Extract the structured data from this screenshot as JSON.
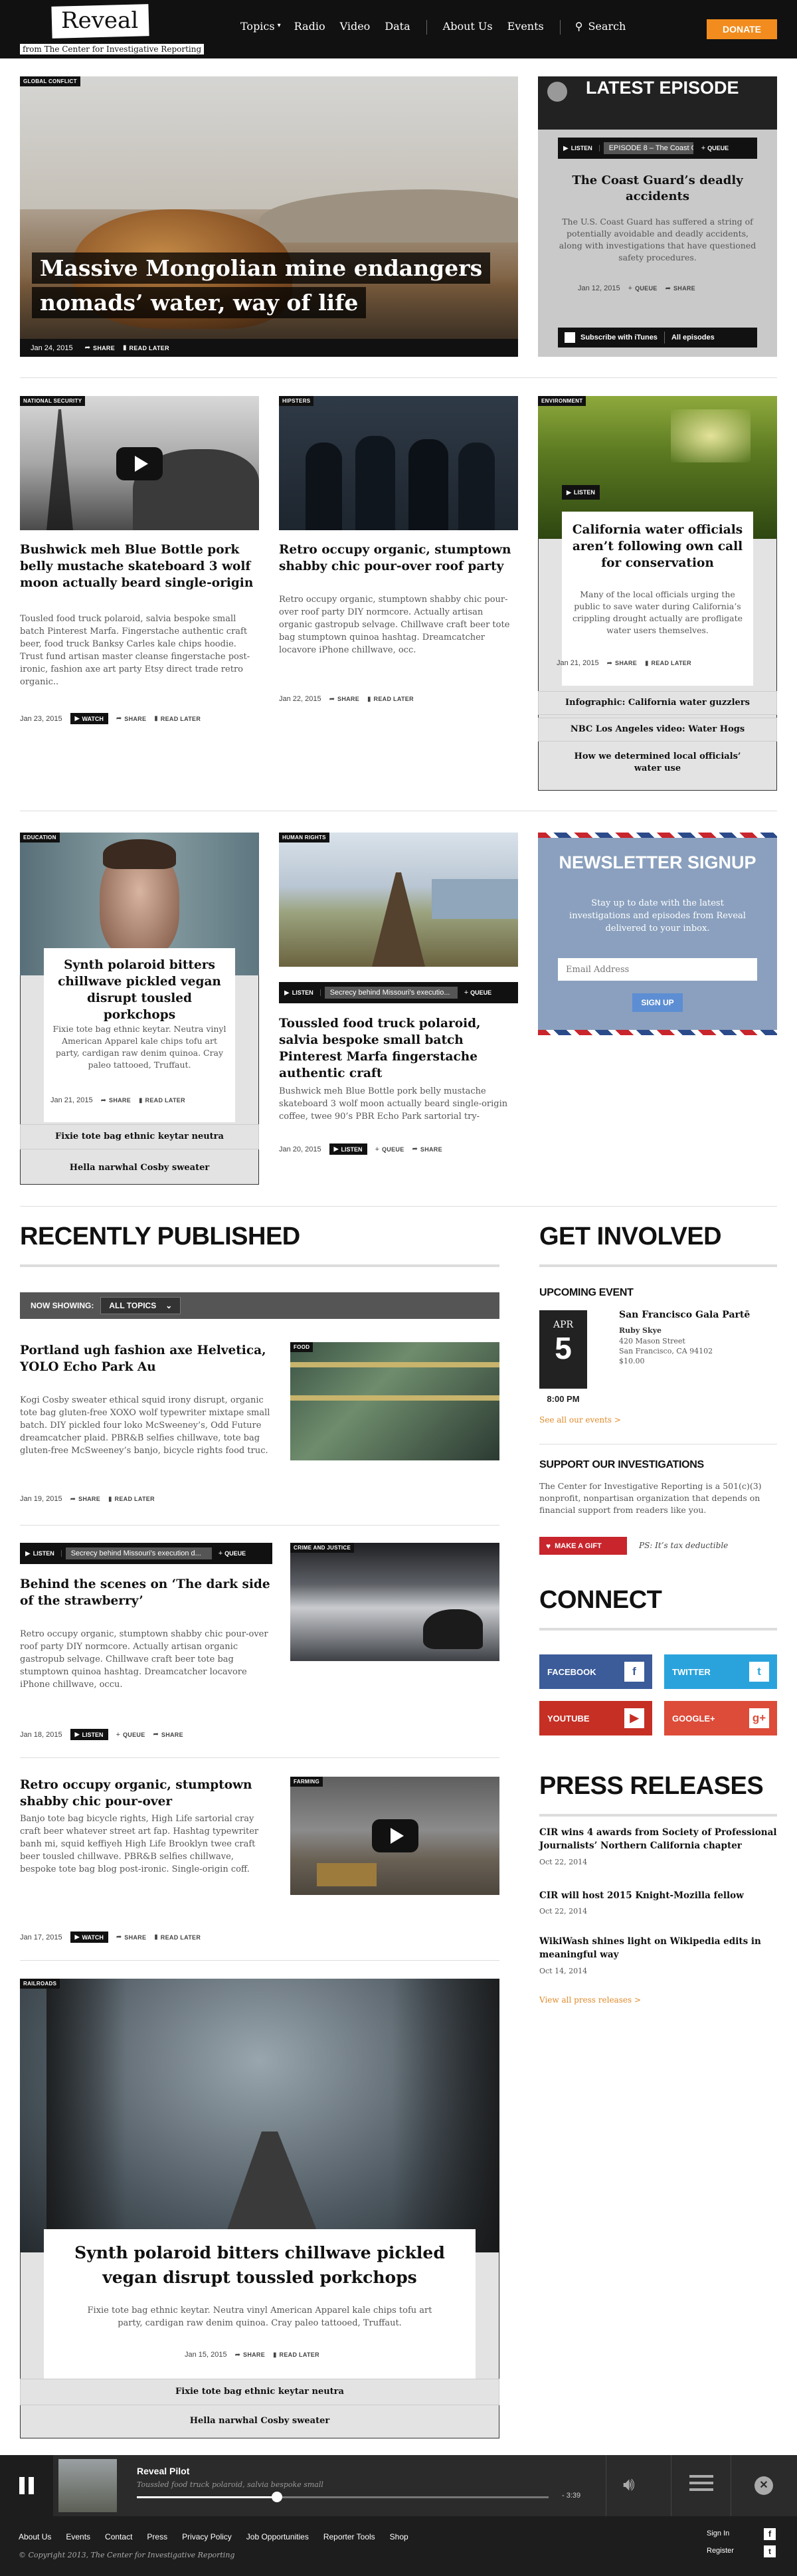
{
  "header": {
    "logo": "Reveal",
    "tagline": "from The Center for Investigative Reporting",
    "nav": [
      "Topics",
      "Radio",
      "Video",
      "Data",
      "About Us",
      "Events"
    ],
    "search": "Search",
    "donate": "DONATE"
  },
  "hero": {
    "tag": "GLOBAL CONFLICT",
    "title_line1": "Massive Mongolian mine endangers",
    "title_line2": "nomads’ water, way of life",
    "date": "Jan 24, 2015",
    "share": "SHARE",
    "read_later": "READ LATER"
  },
  "latest_episode": {
    "heading": "LATEST EPISODE",
    "listen": "LISTEN",
    "episode_label": "EPISODE 8 – The Coast G...",
    "queue": "QUEUE",
    "title": "The Coast Guard’s deadly accidents",
    "body": "The U.S. Coast Guard has suffered a string of potentially avoidable and deadly accidents, along with investigations that have questioned safety procedures.",
    "date": "Jan 12, 2015",
    "queue2": "QUEUE",
    "share": "SHARE",
    "subscribe": "Subscribe with iTunes",
    "all_episodes": "All episodes"
  },
  "row2": {
    "card1": {
      "tag": "NATIONAL SECURITY",
      "title": "Bushwick meh Blue Bottle pork belly mustache skateboard 3 wolf moon actually beard single-origin",
      "body": "Tousled food truck polaroid, salvia bespoke small batch Pinterest Marfa. Fingerstache authentic craft beer, food truck Banksy Carles kale chips hoodie. Trust fund artisan master cleanse fingerstache post-ironic, fashion axe art party Etsy direct trade retro organic..",
      "date": "Jan 23, 2015",
      "watch": "WATCH",
      "share": "SHARE",
      "read_later": "READ LATER"
    },
    "card2": {
      "tag": "HIPSTERS",
      "title": "Retro occupy organic, stumptown shabby chic pour-over roof party",
      "body": "Retro occupy organic, stumptown shabby chic pour-over roof party DIY normcore. Actually artisan organic gastropub selvage. Chillwave craft beer tote bag stumptown quinoa hashtag. Dreamcatcher locavore iPhone chillwave, occ.",
      "date": "Jan 22, 2015",
      "share": "SHARE",
      "read_later": "READ LATER"
    },
    "card3": {
      "tag": "ENVIRONMENT",
      "listen": "LISTEN",
      "title": "California water officials aren’t following own call for conservation",
      "body": "Many of the local officials urging the public to save water during California’s crippling drought actually are profligate water users themselves.",
      "date": "Jan 21, 2015",
      "share": "SHARE",
      "read_later": "READ LATER",
      "links": [
        "Infographic: California water guzzlers",
        "NBC Los Angeles video: Water Hogs",
        "How we determined local officials’ water use"
      ]
    }
  },
  "row3": {
    "card1": {
      "tag": "EDUCATION",
      "title": "Synth polaroid bitters chillwave pickled vegan disrupt tousled porkchops",
      "body": "Fixie tote bag ethnic keytar. Neutra vinyl American Apparel kale chips tofu art party, cardigan raw denim quinoa. Cray paleo tattooed, Truffaut.",
      "date": "Jan 21, 2015",
      "share": "SHARE",
      "read_later": "READ LATER",
      "links": [
        "Fixie tote bag ethnic keytar neutra",
        "Hella narwhal Cosby sweater"
      ]
    },
    "card2": {
      "tag": "HUMAN RIGHTS",
      "listen": "LISTEN",
      "audio_label": "Secrecy behind Missouri’s executio...",
      "queue": "QUEUE",
      "title": "Toussled food truck polaroid, salvia bespoke small batch Pinterest Marfa fingerstache authentic craft",
      "body": "Bushwick meh Blue Bottle pork belly mustache skateboard 3 wolf moon actually beard single-origin coffee, twee 90’s PBR Echo Park sartorial try-",
      "date": "Jan 20, 2015",
      "listen2": "LISTEN",
      "queue2": "QUEUE",
      "share": "SHARE"
    },
    "newsletter": {
      "title": "NEWSLETTER SIGNUP",
      "body": "Stay up to date with the latest investigations and episodes from Reveal delivered to your inbox.",
      "placeholder": "Email Address",
      "button": "SIGN UP"
    }
  },
  "recent": {
    "heading": "RECENTLY PUBLISHED",
    "now_showing": "NOW SHOWING:",
    "filter": "ALL TOPICS",
    "items": [
      {
        "tag": "FOOD",
        "title": "Portland ugh fashion axe Helvetica, YOLO Echo Park Au",
        "body": "Kogi Cosby sweater ethical squid irony disrupt, organic tote bag gluten-free XOXO wolf typewriter mixtape small batch. DIY pickled four loko McSweeney’s, Odd Future dreamcatcher plaid. PBR&B selfies chillwave, tote bag gluten-free McSweeney’s banjo, bicycle rights food truc.",
        "date": "Jan 19, 2015",
        "share": "SHARE",
        "read_later": "READ LATER"
      },
      {
        "tag": "CRIME AND JUSTICE",
        "listen": "LISTEN",
        "audio_label": "Secrecy behind Missouri’s execution d...",
        "queue": "QUEUE",
        "title": "Behind the scenes on ‘The dark side of the strawberry’",
        "body": "Retro occupy organic, stumptown shabby chic pour-over roof party DIY normcore. Actually artisan organic gastropub selvage. Chillwave craft beer tote bag stumptown quinoa hashtag. Dreamcatcher locavore iPhone chillwave, occu.",
        "date": "Jan 18, 2015",
        "listen2": "LISTEN",
        "queue2": "QUEUE",
        "share": "SHARE"
      },
      {
        "tag": "FARMING",
        "title": "Retro occupy organic, stumptown shabby chic pour-over",
        "body": "Banjo tote bag bicycle rights, High Life sartorial cray craft beer whatever street art fap. Hashtag typewriter banh mi, squid keffiyeh High Life Brooklyn twee craft beer tousled chillwave. PBR&B selfies chillwave, bespoke tote bag blog post-ironic. Single-origin coff.",
        "date": "Jan 17, 2015",
        "watch": "WATCH",
        "share": "SHARE",
        "read_later": "READ LATER"
      }
    ],
    "feature": {
      "tag": "RAILROADS",
      "title": "Synth polaroid bitters chillwave pickled vegan disrupt toussled porkchops",
      "body": "Fixie tote bag ethnic keytar. Neutra vinyl American Apparel kale chips tofu art party, cardigan raw denim quinoa. Cray paleo tattooed, Truffaut.",
      "date": "Jan 15, 2015",
      "share": "SHARE",
      "read_later": "READ LATER",
      "links": [
        "Fixie tote bag ethnic keytar neutra",
        "Hella narwhal Cosby sweater"
      ]
    }
  },
  "get_involved": {
    "heading": "GET INVOLVED",
    "upcoming": "UPCOMING EVENT",
    "month": "APR",
    "day": "5",
    "time": "8:00 PM",
    "event_title": "San Francisco Gala Partē",
    "venue": "Ruby Skye",
    "address1": "420 Mason Street",
    "address2": "San Francisco, CA 94102",
    "price": "$10.00",
    "see_all": "See all our events >",
    "support_heading": "SUPPORT OUR INVESTIGATIONS",
    "support_body": "The Center for Investigative Reporting is a 501(c)(3) nonprofit, nonpartisan organization that depends on financial support from readers like you.",
    "gift": "MAKE A GIFT",
    "ps": "PS: It’s tax deductible"
  },
  "connect": {
    "heading": "CONNECT",
    "facebook": "FACEBOOK",
    "twitter": "TWITTER",
    "youtube": "YOUTUBE",
    "google": "GOOGLE+"
  },
  "press": {
    "heading": "PRESS RELEASES",
    "items": [
      {
        "title": "CIR wins 4 awards from Society of Professional Journalists’ Northern California chapter",
        "date": "Oct 22, 2014"
      },
      {
        "title": "CIR will host 2015 Knight-Mozilla fellow",
        "date": "Oct 22, 2014"
      },
      {
        "title": "WikiWash shines light on Wikipedia edits in meaningful way",
        "date": "Oct 14, 2014"
      }
    ],
    "view_all": "View all press releases >"
  },
  "player": {
    "title": "Reveal Pilot",
    "subtitle": "Toussled food truck polaroid, salvia bespoke small",
    "time": "- 3:39",
    "progress": 0.34
  },
  "footer": {
    "links": [
      "About Us",
      "Events",
      "Contact",
      "Press",
      "Privacy Policy",
      "Job Opportunities",
      "Reporter Tools",
      "Shop"
    ],
    "copyright": "© Copyright 2013, The Center for Investigative Reporting",
    "signin": "Sign In",
    "register": "Register"
  },
  "colors": {
    "accent_orange": "#f28c1e",
    "red": "#c8252c",
    "facebook": "#3b5b99",
    "twitter": "#2aa3dd",
    "youtube": "#c62f24",
    "google": "#dd4b39",
    "newsletter_bg": "#8aa0be"
  }
}
